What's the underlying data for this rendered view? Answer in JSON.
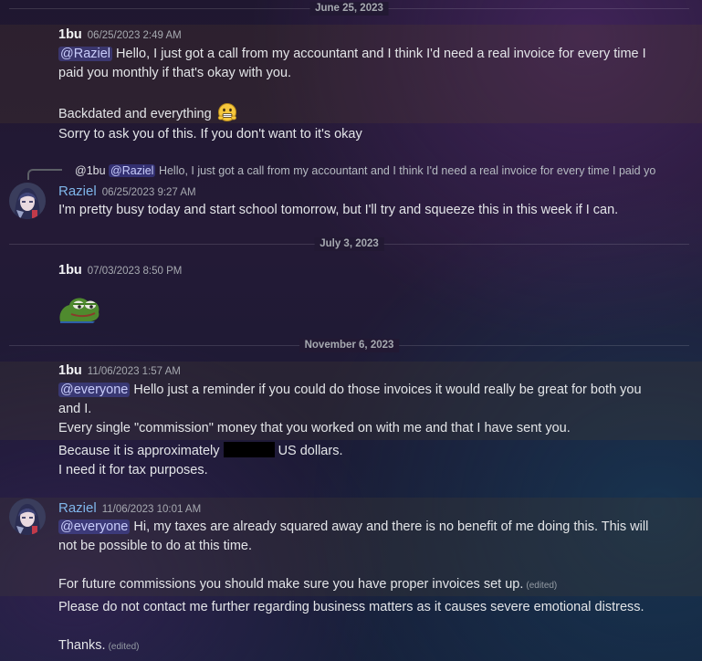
{
  "dividers": [
    "June 25, 2023",
    "July 3, 2023",
    "November 6, 2023"
  ],
  "messages": [
    {
      "author": "1bu",
      "timestamp": "06/25/2023 2:49 AM",
      "mention": "@Raziel",
      "line1": "Hello, I just got a call from my accountant and I think I'd need a real invoice for every time I",
      "line2": "paid you monthly if that's okay with you.",
      "line3": "Backdated and everything",
      "line4": "Sorry to ask you of this. If you don't want to it's okay"
    },
    {
      "author": "Raziel",
      "timestamp": "06/25/2023 9:27 AM",
      "reply_author": "@1bu",
      "reply_mention": "@Raziel",
      "reply_text": "Hello, I just got a call from my accountant and I think I'd need a real invoice for every time I paid yo",
      "line1": "I'm pretty busy today and start school tomorrow, but I'll try and squeeze this in this week if I can."
    },
    {
      "author": "1bu",
      "timestamp": "07/03/2023 8:50 PM",
      "emoji": "pepe-frog-emoji"
    },
    {
      "author": "1bu",
      "timestamp": "11/06/2023 1:57 AM",
      "mention": "@everyone",
      "line1": "Hello just a reminder if you could do those invoices it would really be great for both you",
      "line2": "and I.",
      "line3": "Every single \"commission\" money that you worked on with me and that I have sent you.",
      "line4a": "Because it is approximately",
      "line4b": "US dollars.",
      "line5": "I need it for tax purposes."
    },
    {
      "author": "Raziel",
      "timestamp": "11/06/2023 10:01 AM",
      "mention": "@everyone",
      "line1": "Hi, my taxes are already squared away and there is no benefit of me doing this. This will",
      "line2": "not be possible to do at this time.",
      "line3": "For future commissions you should make sure you have proper invoices set up.",
      "edited": "(edited)",
      "line4": "Please do not contact me further regarding business matters as it causes severe emotional distress.",
      "line5": "Thanks.",
      "edited2": "(edited)"
    }
  ],
  "colors": {
    "mention_bg": "#3b3f8a",
    "raziel_name": "#7fb6ea",
    "highlight": "#3a2f2a"
  }
}
